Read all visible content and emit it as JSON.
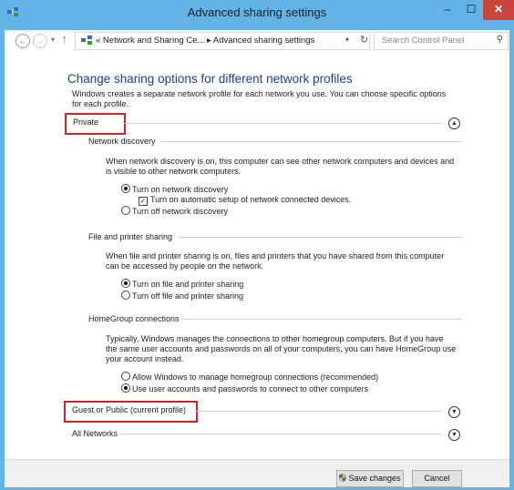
{
  "window": {
    "title": "Advanced sharing settings",
    "controls": {
      "minimize": "–",
      "maximize": "☐",
      "close": "✕"
    }
  },
  "address": {
    "path": "« Network and Sharing Ce... ▸ Advanced sharing settings",
    "search_placeholder": "Search Control Panel"
  },
  "page": {
    "heading": "Change sharing options for different network profiles",
    "description": "Windows creates a separate network profile for each network you use. You can choose specific options for each profile."
  },
  "private": {
    "label": "Private",
    "network_discovery": {
      "label": "Network discovery",
      "text": "When network discovery is on, this computer can see other network computers and devices and is visible to other network computers.",
      "opt_on": "Turn on network discovery",
      "opt_auto": "Turn on automatic setup of network connected devices.",
      "opt_off": "Turn off network discovery"
    },
    "file_sharing": {
      "label": "File and printer sharing",
      "text": "When file and printer sharing is on, files and printers that you have shared from this computer can be accessed by people on the network.",
      "opt_on": "Turn on file and printer sharing",
      "opt_off": "Turn off file and printer sharing"
    },
    "homegroup": {
      "label": "HomeGroup connections",
      "text": "Typically, Windows manages the connections to other homegroup computers. But if you have the same user accounts and passwords on all of your computers, you can have HomeGroup use your account instead.",
      "opt_allow": "Allow Windows to manage homegroup connections (recommended)",
      "opt_user": "Use user accounts and passwords to connect to other computers"
    }
  },
  "guest": {
    "label": "Guest or Public (current profile)"
  },
  "all_networks": {
    "label": "All Networks"
  },
  "buttons": {
    "save": "Save changes",
    "cancel": "Cancel"
  },
  "colors": {
    "titlebar": "#63b3e6",
    "heading": "#1c3f94",
    "highlight": "#d32020",
    "close": "#c9453b"
  }
}
